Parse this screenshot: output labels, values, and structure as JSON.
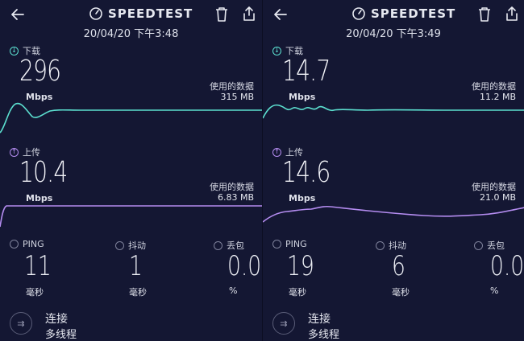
{
  "colors": {
    "background": "#141733",
    "download": "#5ce0d0",
    "upload": "#b48cf0"
  },
  "panels": [
    {
      "brand": "SPEEDTEST",
      "timestamp": "20/04/20 下午3:48",
      "download": {
        "label": "下载",
        "value": "296",
        "unit": "Mbps",
        "data_label": "使用的数据",
        "data_value": "315 MB"
      },
      "upload": {
        "label": "上传",
        "value": "10.4",
        "unit": "Mbps",
        "data_label": "使用的数据",
        "data_value": "6.83 MB"
      },
      "ping": {
        "label": "PING",
        "value": "11",
        "unit": "毫秒"
      },
      "jitter": {
        "label": "抖动",
        "value": "1",
        "unit": "毫秒"
      },
      "loss": {
        "label": "丢包",
        "value": "0.0",
        "unit": "%"
      },
      "connection": {
        "title": "连接",
        "subtitle": "多线程"
      }
    },
    {
      "brand": "SPEEDTEST",
      "timestamp": "20/04/20 下午3:49",
      "download": {
        "label": "下载",
        "value": "14.7",
        "unit": "Mbps",
        "data_label": "使用的数据",
        "data_value": "11.2 MB"
      },
      "upload": {
        "label": "上传",
        "value": "14.6",
        "unit": "Mbps",
        "data_label": "使用的数据",
        "data_value": "21.0 MB"
      },
      "ping": {
        "label": "PING",
        "value": "19",
        "unit": "毫秒"
      },
      "jitter": {
        "label": "抖动",
        "value": "6",
        "unit": "毫秒"
      },
      "loss": {
        "label": "丢包",
        "value": "0.0",
        "unit": "%"
      },
      "connection": {
        "title": "连接",
        "subtitle": "多线程"
      }
    }
  ]
}
